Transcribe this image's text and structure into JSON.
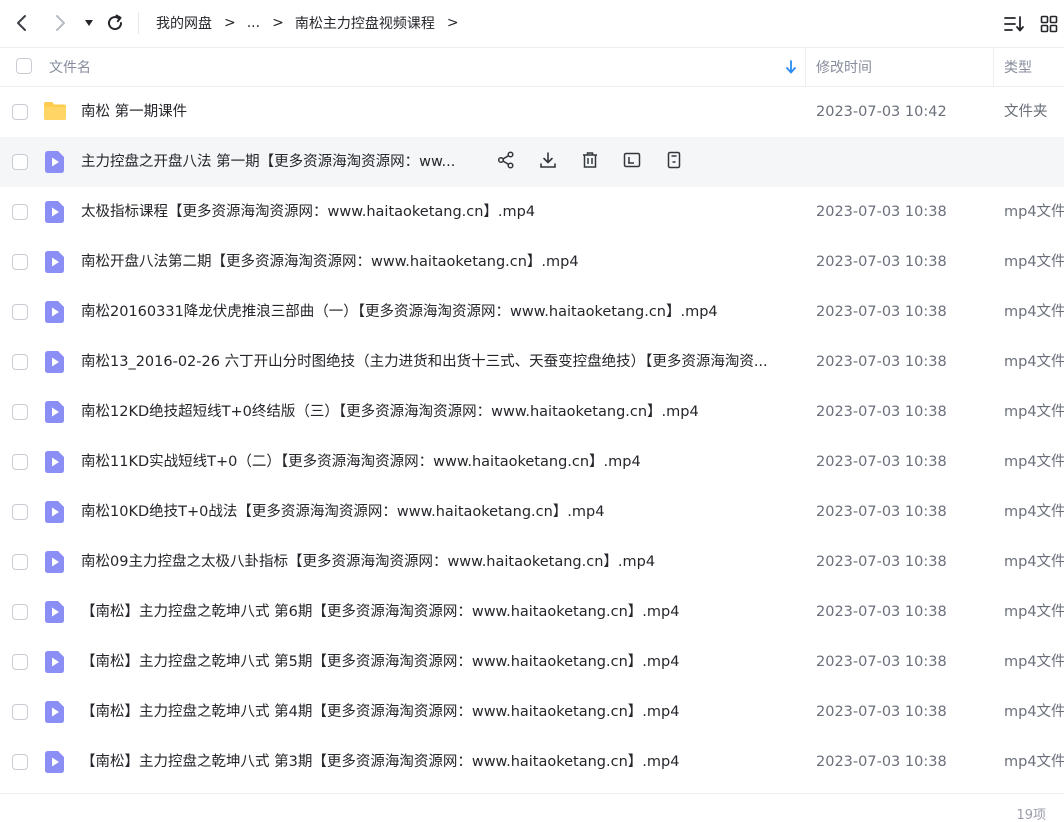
{
  "toolbar": {
    "back_icon": "chevron-left-icon",
    "forward_icon": "chevron-right-icon",
    "history_icon": "caret-down-icon",
    "refresh_icon": "refresh-icon",
    "sort_icon": "sort-list-icon",
    "view_icon": "grid-view-icon"
  },
  "breadcrumb": {
    "items": [
      "我的网盘",
      "...",
      "南松主力控盘视频课程"
    ],
    "separator": ">"
  },
  "header": {
    "name": "文件名",
    "modified": "修改时间",
    "type": "类型",
    "sort_icon": "arrow-down-icon"
  },
  "hover_actions": [
    "share-icon",
    "download-icon",
    "delete-icon",
    "rename-icon",
    "more-icon"
  ],
  "files": [
    {
      "name": "南松 第一期课件",
      "date": "2023-07-03 10:42",
      "type": "文件夹",
      "kind": "folder"
    },
    {
      "name": "主力控盘之开盘八法 第一期【更多资源海淘资源网：ww...",
      "date": "",
      "type": "",
      "kind": "video"
    },
    {
      "name": "太极指标课程【更多资源海淘资源网：www.haitaoketang.cn】.mp4",
      "date": "2023-07-03 10:38",
      "type": "mp4文件",
      "kind": "video"
    },
    {
      "name": "南松开盘八法第二期【更多资源海淘资源网：www.haitaoketang.cn】.mp4",
      "date": "2023-07-03 10:38",
      "type": "mp4文件",
      "kind": "video"
    },
    {
      "name": "南松20160331降龙伏虎推浪三部曲（一）【更多资源海淘资源网：www.haitaoketang.cn】.mp4",
      "date": "2023-07-03 10:38",
      "type": "mp4文件",
      "kind": "video"
    },
    {
      "name": "南松13_2016-02-26 六丁开山分时图绝技（主力进货和出货十三式、天蚕变控盘绝技）【更多资源海淘资...",
      "date": "2023-07-03 10:38",
      "type": "mp4文件",
      "kind": "video"
    },
    {
      "name": "南松12KD绝技超短线T+0终结版（三）【更多资源海淘资源网：www.haitaoketang.cn】.mp4",
      "date": "2023-07-03 10:38",
      "type": "mp4文件",
      "kind": "video"
    },
    {
      "name": "南松11KD实战短线T+0（二）【更多资源海淘资源网：www.haitaoketang.cn】.mp4",
      "date": "2023-07-03 10:38",
      "type": "mp4文件",
      "kind": "video"
    },
    {
      "name": "南松10KD绝技T+0战法【更多资源海淘资源网：www.haitaoketang.cn】.mp4",
      "date": "2023-07-03 10:38",
      "type": "mp4文件",
      "kind": "video"
    },
    {
      "name": "南松09主力控盘之太极八卦指标【更多资源海淘资源网：www.haitaoketang.cn】.mp4",
      "date": "2023-07-03 10:38",
      "type": "mp4文件",
      "kind": "video"
    },
    {
      "name": "【南松】主力控盘之乾坤八式 第6期【更多资源海淘资源网：www.haitaoketang.cn】.mp4",
      "date": "2023-07-03 10:38",
      "type": "mp4文件",
      "kind": "video"
    },
    {
      "name": "【南松】主力控盘之乾坤八式 第5期【更多资源海淘资源网：www.haitaoketang.cn】.mp4",
      "date": "2023-07-03 10:38",
      "type": "mp4文件",
      "kind": "video"
    },
    {
      "name": "【南松】主力控盘之乾坤八式 第4期【更多资源海淘资源网：www.haitaoketang.cn】.mp4",
      "date": "2023-07-03 10:38",
      "type": "mp4文件",
      "kind": "video"
    },
    {
      "name": "【南松】主力控盘之乾坤八式 第3期【更多资源海淘资源网：www.haitaoketang.cn】.mp4",
      "date": "2023-07-03 10:38",
      "type": "mp4文件",
      "kind": "video"
    }
  ],
  "footer": {
    "count": "19项"
  },
  "colors": {
    "folder": "#ffcc4d",
    "video": "#8b8ff5",
    "hover_row": "#f5f6f8",
    "sort_arrow": "#2a8cf4"
  }
}
